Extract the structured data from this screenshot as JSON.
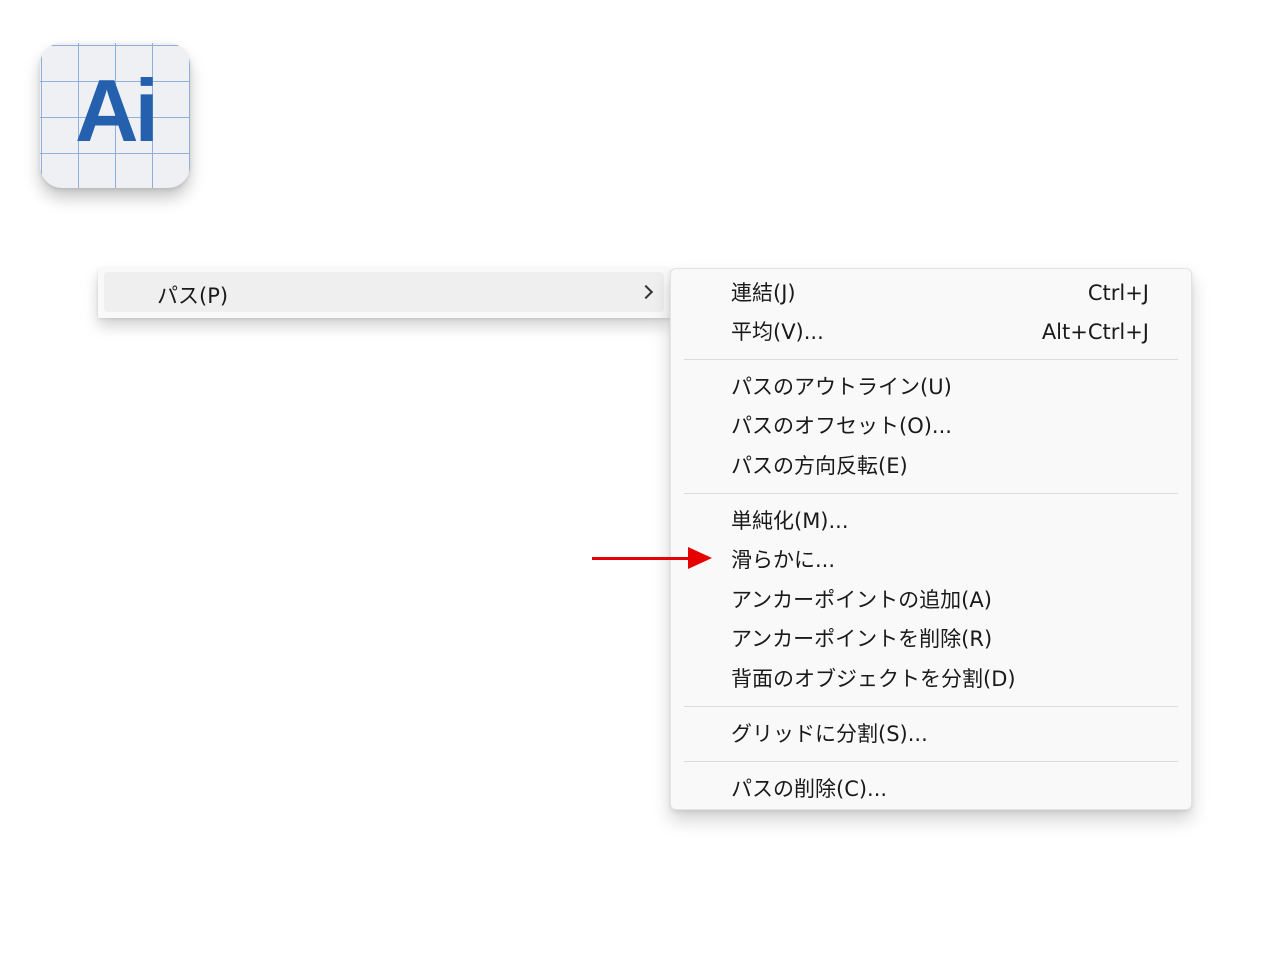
{
  "app_icon": {
    "name": "illustrator-app-icon",
    "text": "Ai",
    "color": "#2460ad"
  },
  "parent_menu": {
    "label": "パス(P)"
  },
  "submenu": {
    "items": [
      {
        "label": "連結(J)",
        "shortcut": "Ctrl+J"
      },
      {
        "label": "平均(V)...",
        "shortcut": "Alt+Ctrl+J"
      },
      {
        "label": "パスのアウトライン(U)",
        "shortcut": ""
      },
      {
        "label": "パスのオフセット(O)...",
        "shortcut": ""
      },
      {
        "label": "パスの方向反転(E)",
        "shortcut": ""
      },
      {
        "label": "単純化(M)...",
        "shortcut": ""
      },
      {
        "label": "滑らかに...",
        "shortcut": ""
      },
      {
        "label": "アンカーポイントの追加(A)",
        "shortcut": ""
      },
      {
        "label": "アンカーポイントを削除(R)",
        "shortcut": ""
      },
      {
        "label": "背面のオブジェクトを分割(D)",
        "shortcut": ""
      },
      {
        "label": "グリッドに分割(S)...",
        "shortcut": ""
      },
      {
        "label": "パスの削除(C)...",
        "shortcut": ""
      }
    ]
  },
  "annotation": {
    "arrow_color": "#e60000"
  }
}
